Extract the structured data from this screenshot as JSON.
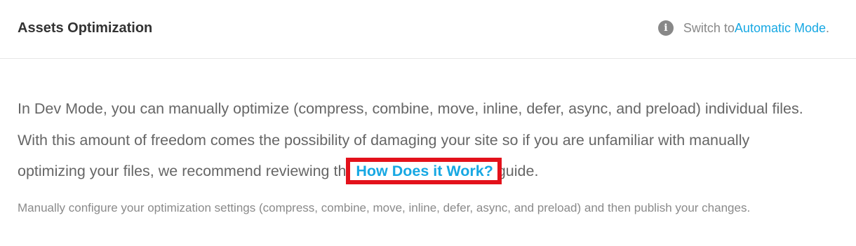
{
  "header": {
    "title": "Assets Optimization",
    "switch_prefix": "Switch to ",
    "switch_link": "Automatic Mode",
    "switch_suffix": ".",
    "info_icon_glyph": "i"
  },
  "intro": {
    "line1": "In Dev Mode, you can manually optimize (compress, combine, move, inline, defer, async, and preload) individual files.",
    "line2": "With this amount of freedom comes the possibility of damaging your site so if you are unfamiliar with manually",
    "line3_before": "optimizing your files, we recommend reviewing the ",
    "line3_link": "How Does it Work?",
    "line3_after": " guide."
  },
  "note": "Manually configure your optimization settings (compress, combine, move, inline, defer, async, and preload) and then publish your changes.",
  "colors": {
    "accent": "#17a8e3",
    "highlight": "#e3111b"
  }
}
